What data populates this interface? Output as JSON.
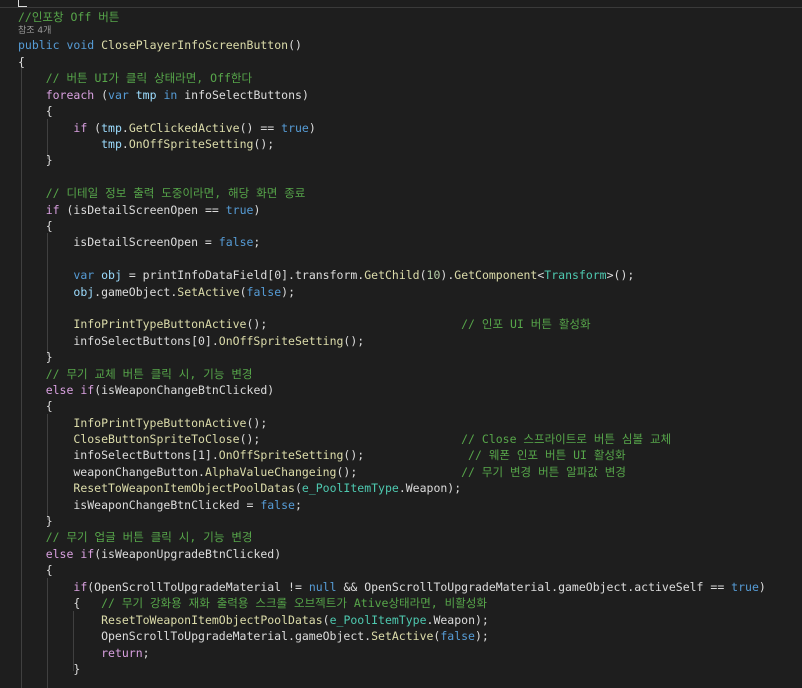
{
  "editor": {
    "references_label": "참조 4개",
    "lines": [
      {
        "tokens": [
          [
            "cm",
            "//인포창 Off 버튼"
          ]
        ]
      },
      {
        "tokens": [
          [
            "kw",
            "public"
          ],
          [
            "tx",
            " "
          ],
          [
            "kw",
            "void"
          ],
          [
            "tx",
            " "
          ],
          [
            "fn",
            "ClosePlayerInfoScreenButton"
          ],
          [
            "tx",
            "()"
          ]
        ]
      },
      {
        "tokens": [
          [
            "tx",
            "{"
          ]
        ]
      },
      {
        "tokens": [
          [
            "tx",
            "    "
          ],
          [
            "cm",
            "// 버튼 UI가 클릭 상태라면, Off한다"
          ]
        ]
      },
      {
        "tokens": [
          [
            "tx",
            "    "
          ],
          [
            "kf",
            "foreach"
          ],
          [
            "tx",
            " ("
          ],
          [
            "kw",
            "var"
          ],
          [
            "tx",
            " "
          ],
          [
            "var",
            "tmp"
          ],
          [
            "tx",
            " "
          ],
          [
            "kw",
            "in"
          ],
          [
            "tx",
            " infoSelectButtons)"
          ]
        ]
      },
      {
        "tokens": [
          [
            "tx",
            "    {"
          ]
        ]
      },
      {
        "tokens": [
          [
            "tx",
            "        "
          ],
          [
            "kf",
            "if"
          ],
          [
            "tx",
            " ("
          ],
          [
            "var",
            "tmp"
          ],
          [
            "tx",
            "."
          ],
          [
            "fn",
            "GetClickedActive"
          ],
          [
            "tx",
            "() == "
          ],
          [
            "kw",
            "true"
          ],
          [
            "tx",
            ")"
          ]
        ]
      },
      {
        "tokens": [
          [
            "tx",
            "            "
          ],
          [
            "var",
            "tmp"
          ],
          [
            "tx",
            "."
          ],
          [
            "fn",
            "OnOffSpriteSetting"
          ],
          [
            "tx",
            "();"
          ]
        ]
      },
      {
        "tokens": [
          [
            "tx",
            "    }"
          ]
        ]
      },
      {
        "tokens": []
      },
      {
        "tokens": [
          [
            "tx",
            "    "
          ],
          [
            "cm",
            "// 디테일 정보 출력 도중이라면, 해당 화면 종료"
          ]
        ]
      },
      {
        "tokens": [
          [
            "tx",
            "    "
          ],
          [
            "kf",
            "if"
          ],
          [
            "tx",
            " (isDetailScreenOpen == "
          ],
          [
            "kw",
            "true"
          ],
          [
            "tx",
            ")"
          ]
        ]
      },
      {
        "tokens": [
          [
            "tx",
            "    {"
          ]
        ]
      },
      {
        "tokens": [
          [
            "tx",
            "        isDetailScreenOpen = "
          ],
          [
            "kw",
            "false"
          ],
          [
            "tx",
            ";"
          ]
        ]
      },
      {
        "tokens": []
      },
      {
        "tokens": [
          [
            "tx",
            "        "
          ],
          [
            "kw",
            "var"
          ],
          [
            "tx",
            " "
          ],
          [
            "var",
            "obj"
          ],
          [
            "tx",
            " = printInfoDataField[0].transform."
          ],
          [
            "fn",
            "GetChild"
          ],
          [
            "tx",
            "("
          ],
          [
            "num",
            "10"
          ],
          [
            "tx",
            ")."
          ],
          [
            "fn",
            "GetComponent"
          ],
          [
            "tx",
            "<"
          ],
          [
            "ty",
            "Transform"
          ],
          [
            "tx",
            ">();"
          ]
        ]
      },
      {
        "tokens": [
          [
            "tx",
            "        "
          ],
          [
            "var",
            "obj"
          ],
          [
            "tx",
            ".gameObject."
          ],
          [
            "fn",
            "SetActive"
          ],
          [
            "tx",
            "("
          ],
          [
            "kw",
            "false"
          ],
          [
            "tx",
            ");"
          ]
        ]
      },
      {
        "tokens": []
      },
      {
        "tokens": [
          [
            "tx",
            "        "
          ],
          [
            "fn",
            "InfoPrintTypeButtonActive"
          ],
          [
            "tx",
            "();                            "
          ],
          [
            "cm",
            "// 인포 UI 버튼 활성화"
          ]
        ]
      },
      {
        "tokens": [
          [
            "tx",
            "        infoSelectButtons[0]."
          ],
          [
            "fn",
            "OnOffSpriteSetting"
          ],
          [
            "tx",
            "();"
          ]
        ]
      },
      {
        "tokens": [
          [
            "tx",
            "    }"
          ]
        ]
      },
      {
        "tokens": [
          [
            "tx",
            "    "
          ],
          [
            "cm",
            "// 무기 교체 버튼 클릭 시, 기능 변경"
          ]
        ]
      },
      {
        "tokens": [
          [
            "tx",
            "    "
          ],
          [
            "kf",
            "else"
          ],
          [
            "tx",
            " "
          ],
          [
            "kf",
            "if"
          ],
          [
            "tx",
            "(isWeaponChangeBtnClicked)"
          ]
        ]
      },
      {
        "tokens": [
          [
            "tx",
            "    {"
          ]
        ]
      },
      {
        "tokens": [
          [
            "tx",
            "        "
          ],
          [
            "fn",
            "InfoPrintTypeButtonActive"
          ],
          [
            "tx",
            "();"
          ]
        ]
      },
      {
        "tokens": [
          [
            "tx",
            "        "
          ],
          [
            "fn",
            "CloseButtonSpriteToClose"
          ],
          [
            "tx",
            "();                             "
          ],
          [
            "cm",
            "// Close 스프라이트로 버튼 심볼 교체"
          ]
        ]
      },
      {
        "tokens": [
          [
            "tx",
            "        infoSelectButtons[1]."
          ],
          [
            "fn",
            "OnOffSpriteSetting"
          ],
          [
            "tx",
            "();               "
          ],
          [
            "cm",
            "// 웨폰 인포 버튼 UI 활성화"
          ]
        ]
      },
      {
        "tokens": [
          [
            "tx",
            "        weaponChangeButton."
          ],
          [
            "fn",
            "AlphaValueChangeing"
          ],
          [
            "tx",
            "();               "
          ],
          [
            "cm",
            "// 무기 변경 버튼 알파값 변경"
          ]
        ]
      },
      {
        "tokens": [
          [
            "tx",
            "        "
          ],
          [
            "fn",
            "ResetToWeaponItemObjectPoolDatas"
          ],
          [
            "tx",
            "("
          ],
          [
            "ty",
            "e_PoolItemType"
          ],
          [
            "tx",
            ".Weapon);"
          ]
        ]
      },
      {
        "tokens": [
          [
            "tx",
            "        isWeaponChangeBtnClicked = "
          ],
          [
            "kw",
            "false"
          ],
          [
            "tx",
            ";"
          ]
        ]
      },
      {
        "tokens": [
          [
            "tx",
            "    }"
          ]
        ]
      },
      {
        "tokens": [
          [
            "tx",
            "    "
          ],
          [
            "cm",
            "// 무기 업글 버튼 클릭 시, 기능 변경"
          ]
        ]
      },
      {
        "tokens": [
          [
            "tx",
            "    "
          ],
          [
            "kf",
            "else"
          ],
          [
            "tx",
            " "
          ],
          [
            "kf",
            "if"
          ],
          [
            "tx",
            "(isWeaponUpgradeBtnClicked)"
          ]
        ]
      },
      {
        "tokens": [
          [
            "tx",
            "    {"
          ]
        ]
      },
      {
        "tokens": [
          [
            "tx",
            "        "
          ],
          [
            "kf",
            "if"
          ],
          [
            "tx",
            "(OpenScrollToUpgradeMaterial != "
          ],
          [
            "kw",
            "null"
          ],
          [
            "tx",
            " && OpenScrollToUpgradeMaterial.gameObject.activeSelf == "
          ],
          [
            "kw",
            "true"
          ],
          [
            "tx",
            ")"
          ]
        ]
      },
      {
        "tokens": [
          [
            "tx",
            "        {   "
          ],
          [
            "cm",
            "// 무기 강화용 재화 출력용 스크롤 오브젝트가 Ative상태라면, 비활성화"
          ]
        ]
      },
      {
        "tokens": [
          [
            "tx",
            "            "
          ],
          [
            "fn",
            "ResetToWeaponItemObjectPoolDatas"
          ],
          [
            "tx",
            "("
          ],
          [
            "ty",
            "e_PoolItemType"
          ],
          [
            "tx",
            ".Weapon);"
          ]
        ]
      },
      {
        "tokens": [
          [
            "tx",
            "            OpenScrollToUpgradeMaterial.gameObject."
          ],
          [
            "fn",
            "SetActive"
          ],
          [
            "tx",
            "("
          ],
          [
            "kw",
            "false"
          ],
          [
            "tx",
            ");"
          ]
        ]
      },
      {
        "tokens": [
          [
            "tx",
            "            "
          ],
          [
            "kf",
            "return"
          ],
          [
            "tx",
            ";"
          ]
        ]
      },
      {
        "tokens": [
          [
            "tx",
            "        }"
          ]
        ]
      }
    ]
  }
}
